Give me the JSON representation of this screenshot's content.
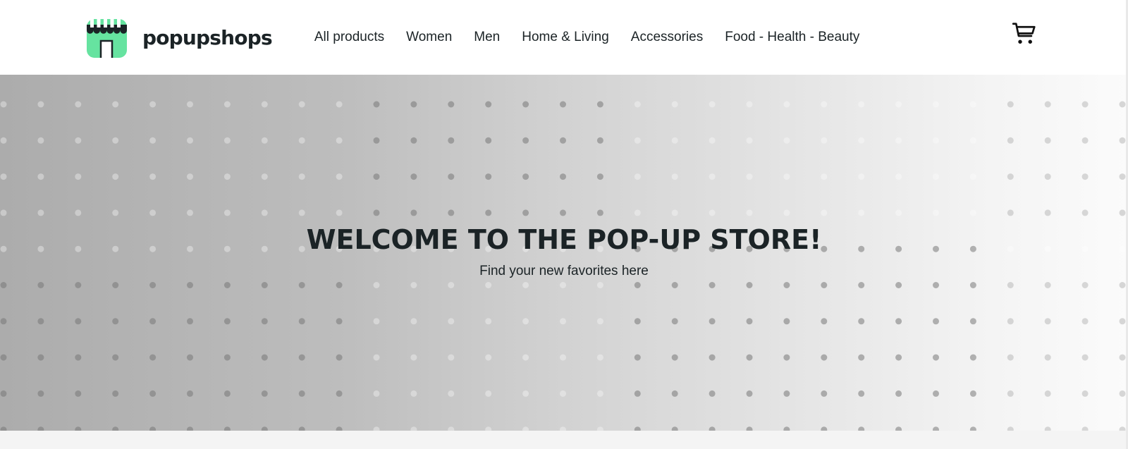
{
  "brand": {
    "name": "popupshops",
    "logo_icon": "storefront-awning-icon",
    "accent_color": "#66e3a0"
  },
  "nav": {
    "items": [
      {
        "label": "All products"
      },
      {
        "label": "Women"
      },
      {
        "label": "Men"
      },
      {
        "label": "Home & Living"
      },
      {
        "label": "Accessories"
      },
      {
        "label": "Food - Health - Beauty"
      }
    ]
  },
  "cart": {
    "icon": "shopping-cart-icon"
  },
  "hero": {
    "title": "WELCOME TO THE POP-UP STORE!",
    "subtitle": "Find your new favorites here",
    "pattern": "dot-grid"
  },
  "colors": {
    "text": "#1b2326",
    "header_bg": "#ffffff",
    "page_bg": "#f5f5f5"
  }
}
